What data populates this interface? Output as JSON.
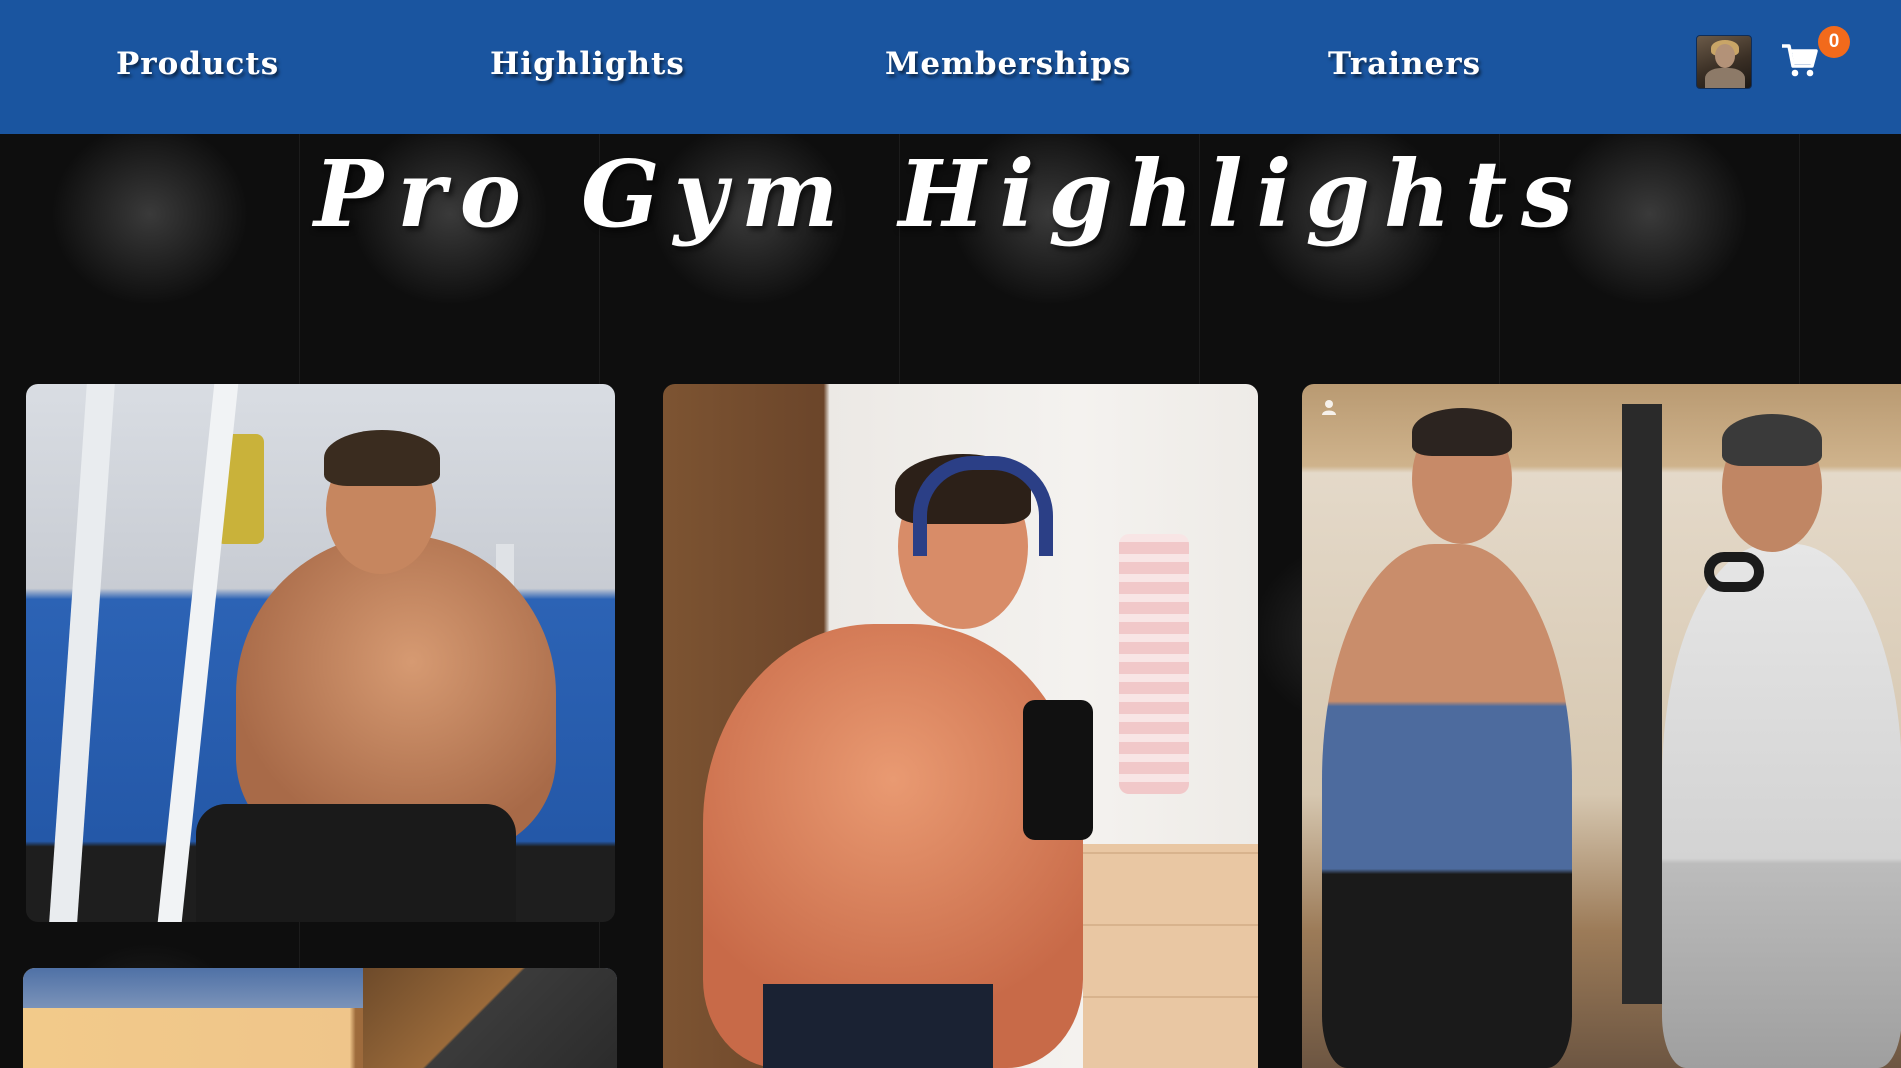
{
  "navbar": {
    "links": [
      "Products",
      "Highlights",
      "Memberships",
      "Trainers"
    ],
    "cart_count": "0",
    "avatar_icon": "user-avatar",
    "cart_icon": "shopping-cart-icon",
    "colors": {
      "background": "#1a55a0",
      "badge": "#f26a1b"
    }
  },
  "hero": {
    "title": "Pro Gym Highlights"
  },
  "gallery": [
    {
      "name": "highlight-photo-1"
    },
    {
      "name": "highlight-photo-2"
    },
    {
      "name": "highlight-photo-3"
    },
    {
      "name": "highlight-photo-4"
    }
  ]
}
